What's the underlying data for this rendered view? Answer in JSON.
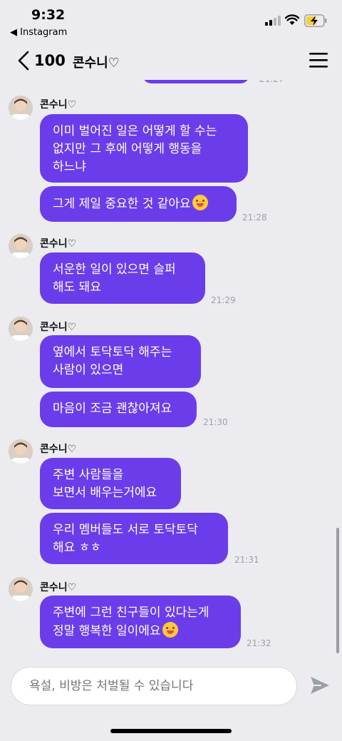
{
  "status_bar": {
    "time": "9:32",
    "back_app": "◀ Instagram"
  },
  "header": {
    "unread_count": "100",
    "title": "콘수니♡"
  },
  "colors": {
    "bubble": "#6b3dea",
    "background": "#ebebf0"
  },
  "messages": [
    {
      "sender": "콘수니♡",
      "bubbles": [
        "이미 벌어진 일은 어떻게 할 수는\n없지만 그 후에 어떻게 행동을\n하느냐",
        "그게 제일 중요한 것 같아요"
      ],
      "emoji": "smiling-face-with-hand-over-mouth",
      "time": "21:28"
    },
    {
      "sender": "콘수니♡",
      "bubbles": [
        "서운한 일이 있으면 슬퍼\n해도 돼요"
      ],
      "time": "21:29"
    },
    {
      "sender": "콘수니♡",
      "bubbles": [
        "옆에서 토닥토닥 해주는\n사람이 있으면",
        "마음이 조금 괜찮아져요"
      ],
      "time": "21:30"
    },
    {
      "sender": "콘수니♡",
      "bubbles": [
        "주변 사람들을\n보면서 배우는거에요",
        "우리 멤버들도 서로 토닥토닥\n해요 ㅎㅎ"
      ],
      "time": "21:31"
    },
    {
      "sender": "콘수니♡",
      "bubbles": [
        "주변에 그런 친구들이 있다는게\n정말 행복한 일이에요"
      ],
      "emoji": "smiling-face-with-hearts",
      "time": "21:32"
    }
  ],
  "composer": {
    "placeholder": "욕설, 비방은 처벌될 수 있습니다"
  }
}
